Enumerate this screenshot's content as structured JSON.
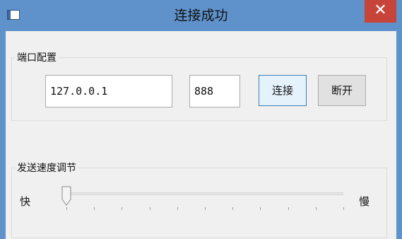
{
  "window": {
    "title": "连接成功",
    "close_glyph": "✕"
  },
  "port_config": {
    "group_title": "端口配置",
    "ip_value": "127.0.0.1",
    "port_value": "888",
    "connect_label": "连接",
    "disconnect_label": "断开"
  },
  "speed": {
    "group_title": "发送速度调节",
    "fast_label": "快",
    "slow_label": "慢",
    "slider_position": 0,
    "tick_count": 10
  },
  "colors": {
    "titlebar": "#5f92cb",
    "close_button": "#c7443a",
    "client_bg": "#f0f0f0",
    "connect_focus_border": "#3c7fb1"
  }
}
